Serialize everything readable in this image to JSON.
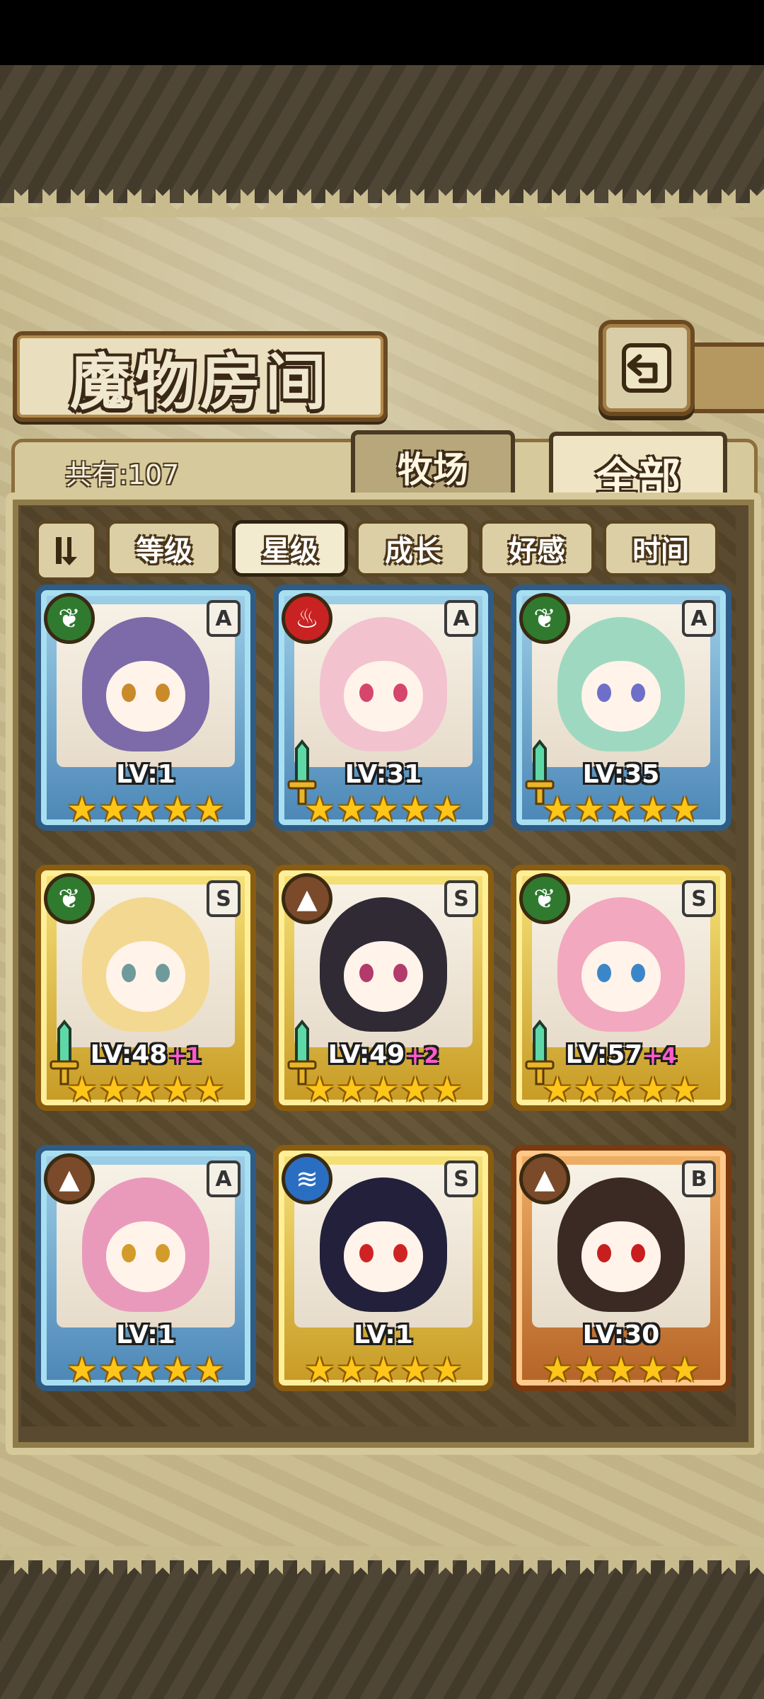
{
  "header": {
    "title": "魔物房间",
    "count_label": "共有:107"
  },
  "tabs": [
    {
      "label": "牧场",
      "active": false
    },
    {
      "label": "全部",
      "active": true
    }
  ],
  "sort_buttons": [
    {
      "label": "等级",
      "active": false
    },
    {
      "label": "星级",
      "active": true
    },
    {
      "label": "成长",
      "active": false
    },
    {
      "label": "好感",
      "active": false
    },
    {
      "label": "时间",
      "active": false
    }
  ],
  "icons": {
    "sort_toggle": "sort-order-icon",
    "back": "back-return-icon"
  },
  "monsters": [
    {
      "level": "LV:1",
      "plus": "",
      "rank": "A",
      "element": "grass",
      "frame": "blue",
      "stars": 5,
      "weapon": false,
      "hair": "#7c6aa9",
      "eye": "#c98a2a"
    },
    {
      "level": "LV:31",
      "plus": "",
      "rank": "A",
      "element": "fire",
      "frame": "blue",
      "stars": 5,
      "weapon": true,
      "hair": "#f2c2cf",
      "eye": "#d6456b"
    },
    {
      "level": "LV:35",
      "plus": "",
      "rank": "A",
      "element": "grass",
      "frame": "blue",
      "stars": 5,
      "weapon": true,
      "hair": "#9ed8c1",
      "eye": "#6d6fc8"
    },
    {
      "level": "LV:48",
      "plus": "+1",
      "rank": "S",
      "element": "grass",
      "frame": "gold",
      "stars": 5,
      "weapon": true,
      "hair": "#f3d892",
      "eye": "#6f9a9c"
    },
    {
      "level": "LV:49",
      "plus": "+2",
      "rank": "S",
      "element": "earth",
      "frame": "gold",
      "stars": 5,
      "weapon": true,
      "hair": "#2f2a34",
      "eye": "#b23b6a"
    },
    {
      "level": "LV:57",
      "plus": "+4",
      "rank": "S",
      "element": "grass",
      "frame": "gold",
      "stars": 5,
      "weapon": true,
      "hair": "#f2a8be",
      "eye": "#3b86c8"
    },
    {
      "level": "LV:1",
      "plus": "",
      "rank": "A",
      "element": "earth",
      "frame": "blue",
      "stars": 5,
      "weapon": false,
      "hair": "#e99abb",
      "eye": "#d39b2a"
    },
    {
      "level": "LV:1",
      "plus": "",
      "rank": "S",
      "element": "water",
      "frame": "gold",
      "stars": 5,
      "weapon": false,
      "hair": "#22203a",
      "eye": "#cf2323"
    },
    {
      "level": "LV:30",
      "plus": "",
      "rank": "B",
      "element": "earth",
      "frame": "bronze",
      "stars": 5,
      "weapon": false,
      "hair": "#3b2a24",
      "eye": "#c81e1e"
    }
  ]
}
